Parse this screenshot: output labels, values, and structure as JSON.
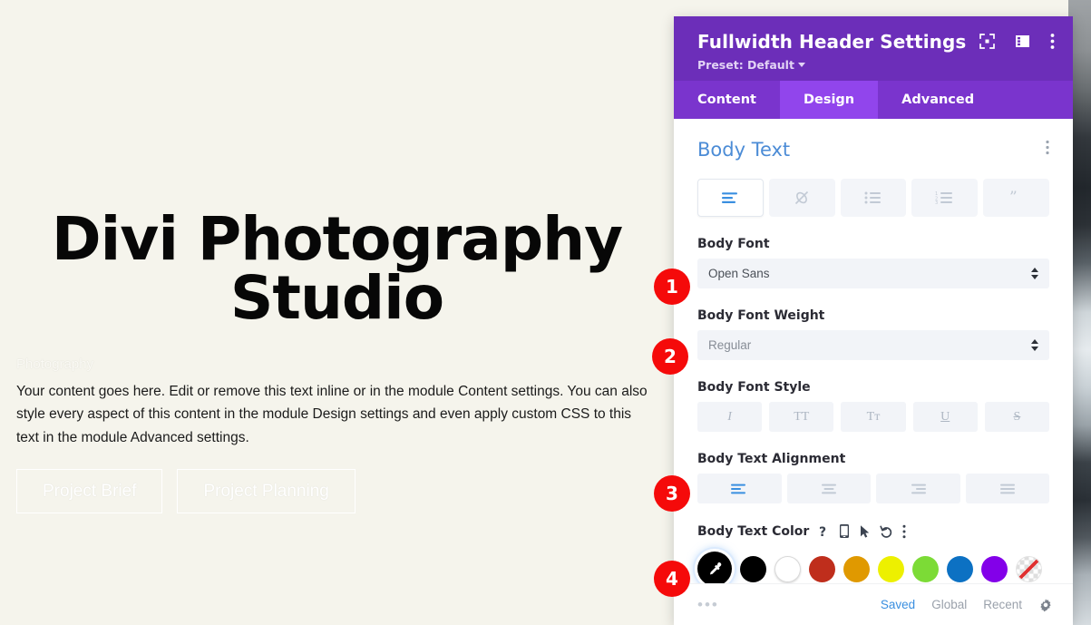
{
  "canvas": {
    "hero_title": "Divi Photography Studio",
    "hero_subtitle": "Photography",
    "hero_body": "Your content goes here. Edit or remove this text inline or in the module Content settings. You can also style every aspect of this content in the module Design settings and even apply custom CSS to this text in the module Advanced settings.",
    "buttons": [
      {
        "label": "Project Brief"
      },
      {
        "label": "Project Planning"
      }
    ],
    "background_color": "#f5f4ec",
    "title_color": "#070707"
  },
  "panel": {
    "title": "Fullwidth Header Settings",
    "preset_label": "Preset: Default",
    "header_color": "#6c2eb9",
    "tab_active_color": "#9145ec",
    "header_icons": [
      {
        "name": "focus-icon"
      },
      {
        "name": "layout-panel-icon"
      },
      {
        "name": "more-vertical-icon"
      }
    ],
    "tabs": [
      {
        "label": "Content",
        "active": false
      },
      {
        "label": "Design",
        "active": true
      },
      {
        "label": "Advanced",
        "active": false
      }
    ],
    "section": {
      "title": "Body Text",
      "title_color": "#4c8cd6",
      "menu_icon": "more-vertical-icon",
      "toolbar": [
        {
          "name": "paragraph-icon",
          "active": true
        },
        {
          "name": "link-off-icon",
          "active": false
        },
        {
          "name": "bullet-list-icon",
          "active": false
        },
        {
          "name": "numbered-list-icon",
          "active": false
        },
        {
          "name": "blockquote-icon",
          "active": false
        }
      ]
    },
    "fields": {
      "body_font": {
        "label": "Body Font",
        "value": "Open Sans"
      },
      "body_font_weight": {
        "label": "Body Font Weight",
        "value": "Regular"
      },
      "body_font_style": {
        "label": "Body Font Style",
        "options": [
          {
            "glyph": "I",
            "name": "italic-button"
          },
          {
            "glyph": "TT",
            "name": "uppercase-button"
          },
          {
            "glyph": "Tᴛ",
            "name": "capitalize-button"
          },
          {
            "glyph": "U",
            "name": "underline-button"
          },
          {
            "glyph": "S",
            "name": "strikethrough-button"
          }
        ]
      },
      "body_text_alignment": {
        "label": "Body Text Alignment",
        "options": [
          {
            "name": "align-left-button",
            "active": true
          },
          {
            "name": "align-center-button",
            "active": false
          },
          {
            "name": "align-right-button",
            "active": false
          },
          {
            "name": "align-justify-button",
            "active": false
          }
        ]
      },
      "body_text_color": {
        "label": "Body Text Color",
        "icons": [
          {
            "name": "help-icon",
            "glyph": "?"
          },
          {
            "name": "responsive-mobile-icon"
          },
          {
            "name": "hover-cursor-icon"
          },
          {
            "name": "reset-undo-icon"
          },
          {
            "name": "more-vertical-icon"
          }
        ],
        "swatches": [
          {
            "name": "eyedropper-picker",
            "color": "#000000",
            "selected": true
          },
          {
            "name": "swatch-black",
            "color": "#000000"
          },
          {
            "name": "swatch-white",
            "color": "#ffffff"
          },
          {
            "name": "swatch-red",
            "color": "#bf2e1c"
          },
          {
            "name": "swatch-orange",
            "color": "#e09900"
          },
          {
            "name": "swatch-yellow",
            "color": "#edf000"
          },
          {
            "name": "swatch-green",
            "color": "#7cdb36"
          },
          {
            "name": "swatch-blue",
            "color": "#0c71c3"
          },
          {
            "name": "swatch-purple",
            "color": "#8300e9"
          },
          {
            "name": "swatch-transparent",
            "color": "none"
          }
        ]
      }
    },
    "footer": {
      "more_label": "•••",
      "links": [
        {
          "label": "Saved",
          "active": true
        },
        {
          "label": "Global",
          "active": false
        },
        {
          "label": "Recent",
          "active": false
        }
      ],
      "gear_icon": "settings-gear-icon"
    }
  },
  "badges": [
    {
      "number": "1"
    },
    {
      "number": "2"
    },
    {
      "number": "3"
    },
    {
      "number": "4"
    }
  ]
}
